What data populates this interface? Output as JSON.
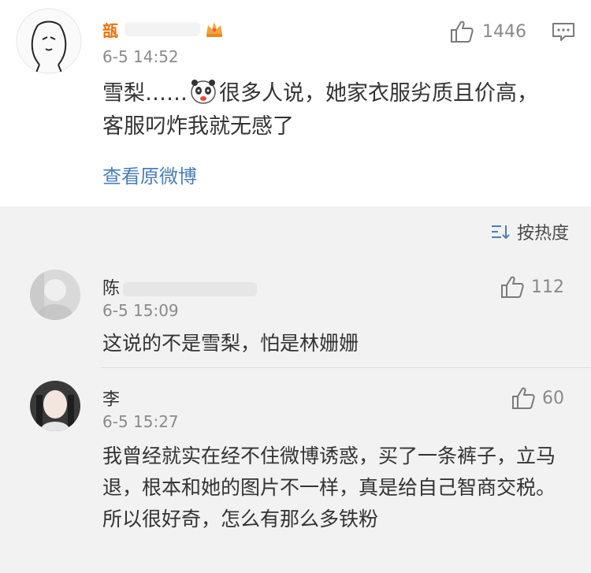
{
  "main_comment": {
    "username_visible": "瓿",
    "time": "6-5 14:52",
    "text_before_emoji": "雪梨……",
    "text_after_emoji": "很多人说，她家衣服劣质且价高，客服叼炸我就无感了",
    "view_original": "查看原微博",
    "likes": "1446",
    "icons": {
      "like": "thumbs-up-icon",
      "comment": "comment-icon",
      "crown": "crown-icon",
      "emoji": "panda-emoji-icon"
    }
  },
  "sort": {
    "label": "按热度",
    "icon": "sort-icon"
  },
  "replies": [
    {
      "username": "陈",
      "time": "6-5 15:09",
      "text": "这说的不是雪梨，怕是林姗姗",
      "likes": "112"
    },
    {
      "username": "李",
      "time": "6-5 15:27",
      "text": "我曾经就实在经不住微博诱惑，买了一条裤子，立马退，根本和她的图片不一样，真是给自己智商交税。所以很好奇，怎么有那么多铁粉",
      "likes": "60"
    }
  ],
  "colors": {
    "username_main": "#e8740c",
    "link": "#4a7fb5",
    "meta": "#8a8a8a",
    "background": "#f2f2f2"
  }
}
